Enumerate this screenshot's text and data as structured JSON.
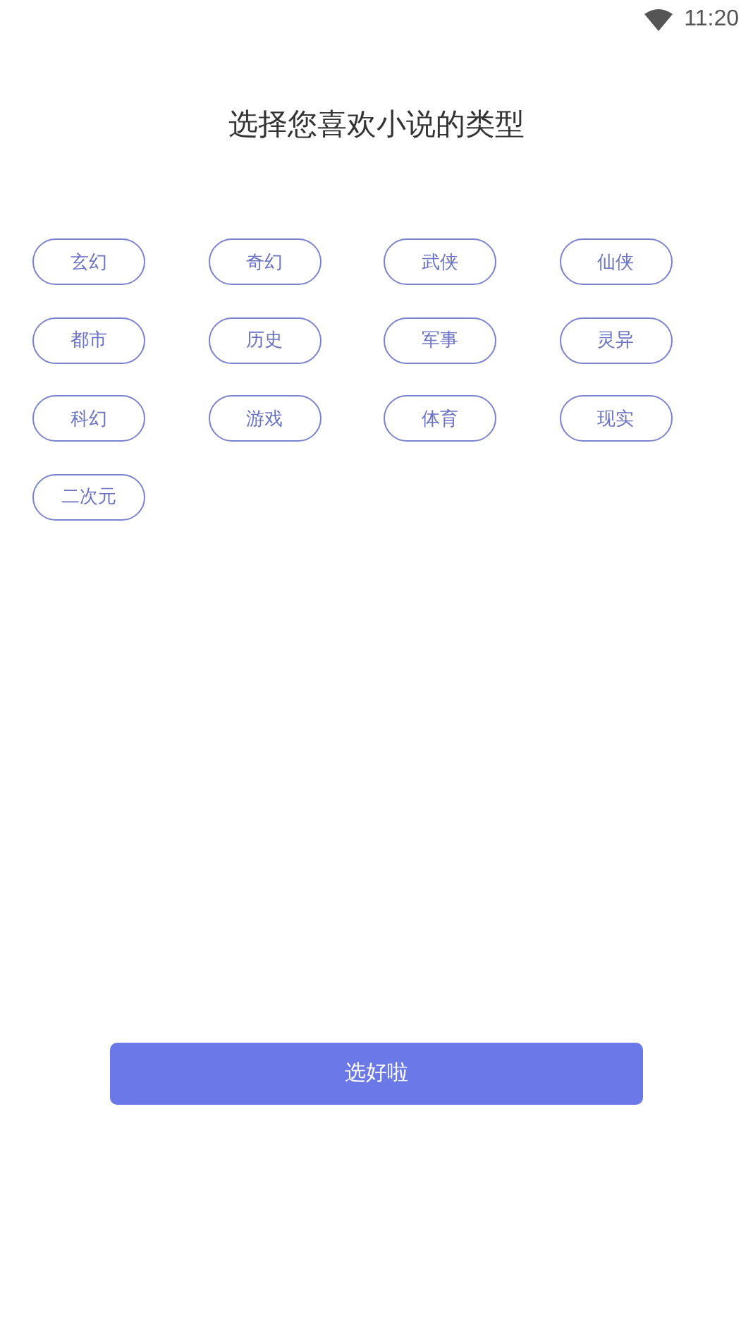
{
  "status_bar": {
    "time": "11:20"
  },
  "title": "选择您喜欢小说的类型",
  "genres": [
    {
      "label": "玄幻",
      "selected": false
    },
    {
      "label": "奇幻",
      "selected": false
    },
    {
      "label": "武侠",
      "selected": false
    },
    {
      "label": "仙侠",
      "selected": false
    },
    {
      "label": "都市",
      "selected": false
    },
    {
      "label": "历史",
      "selected": false
    },
    {
      "label": "军事",
      "selected": false
    },
    {
      "label": "灵异",
      "selected": false
    },
    {
      "label": "科幻",
      "selected": false
    },
    {
      "label": "游戏",
      "selected": false
    },
    {
      "label": "体育",
      "selected": false
    },
    {
      "label": "现实",
      "selected": false
    },
    {
      "label": "二次元",
      "selected": false
    }
  ],
  "confirm_button": "选好啦"
}
